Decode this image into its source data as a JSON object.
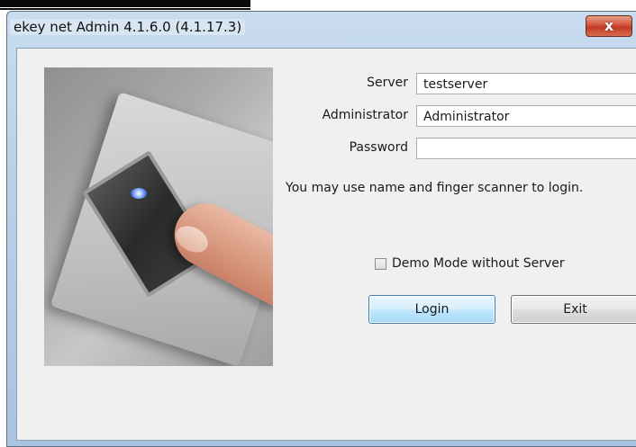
{
  "window": {
    "title": "ekey net Admin 4.1.6.0 (4.1.17.3)",
    "close_icon": "x"
  },
  "form": {
    "server_label": "Server",
    "server_value": "testserver",
    "admin_label": "Administrator",
    "admin_value": "Administrator",
    "password_label": "Password",
    "password_value": "",
    "hint": "You may use name and finger scanner to login."
  },
  "demo": {
    "label": "Demo Mode without Server",
    "checked": false
  },
  "buttons": {
    "login": "Login",
    "exit": "Exit"
  },
  "colors": {
    "login_border": "#3c7fb1",
    "close_red": "#c03a22"
  }
}
